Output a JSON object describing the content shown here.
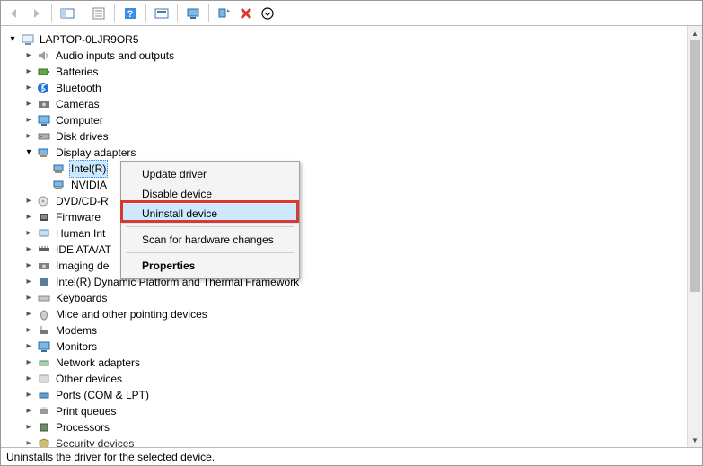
{
  "toolbar": {
    "back": "back-icon",
    "forward": "forward-icon",
    "console": "show-hide-console-tree-icon",
    "properties": "properties-icon",
    "help": "help-icon",
    "action": "action-icon",
    "remote": "remote-icon",
    "scan": "scan-icon",
    "remove": "remove-icon",
    "toggle": "toggle-icon"
  },
  "root_label": "LAPTOP-0LJR9OR5",
  "categories": [
    {
      "label": "Audio inputs and outputs"
    },
    {
      "label": "Batteries"
    },
    {
      "label": "Bluetooth"
    },
    {
      "label": "Cameras"
    },
    {
      "label": "Computer"
    },
    {
      "label": "Disk drives"
    },
    {
      "label": "Display adapters",
      "expanded": true,
      "children": [
        {
          "label": "Intel(R)",
          "selected": true
        },
        {
          "label": "NVIDIA"
        }
      ]
    },
    {
      "label": "DVD/CD-R"
    },
    {
      "label": "Firmware"
    },
    {
      "label": "Human Int"
    },
    {
      "label": "IDE ATA/AT"
    },
    {
      "label": "Imaging de"
    },
    {
      "label": "Intel(R) Dynamic Platform and Thermal Framework"
    },
    {
      "label": "Keyboards"
    },
    {
      "label": "Mice and other pointing devices"
    },
    {
      "label": "Modems"
    },
    {
      "label": "Monitors"
    },
    {
      "label": "Network adapters"
    },
    {
      "label": "Other devices"
    },
    {
      "label": "Ports (COM & LPT)"
    },
    {
      "label": "Print queues"
    },
    {
      "label": "Processors"
    },
    {
      "label": "Security devices"
    }
  ],
  "context_menu": {
    "items": [
      {
        "label": "Update driver"
      },
      {
        "label": "Disable device"
      },
      {
        "label": "Uninstall device",
        "highlighted": true
      }
    ],
    "items2": [
      {
        "label": "Scan for hardware changes"
      }
    ],
    "items3": [
      {
        "label": "Properties",
        "bold": true
      }
    ]
  },
  "statusbar": "Uninstalls the driver for the selected device.",
  "callout_color": "#d73a2d"
}
